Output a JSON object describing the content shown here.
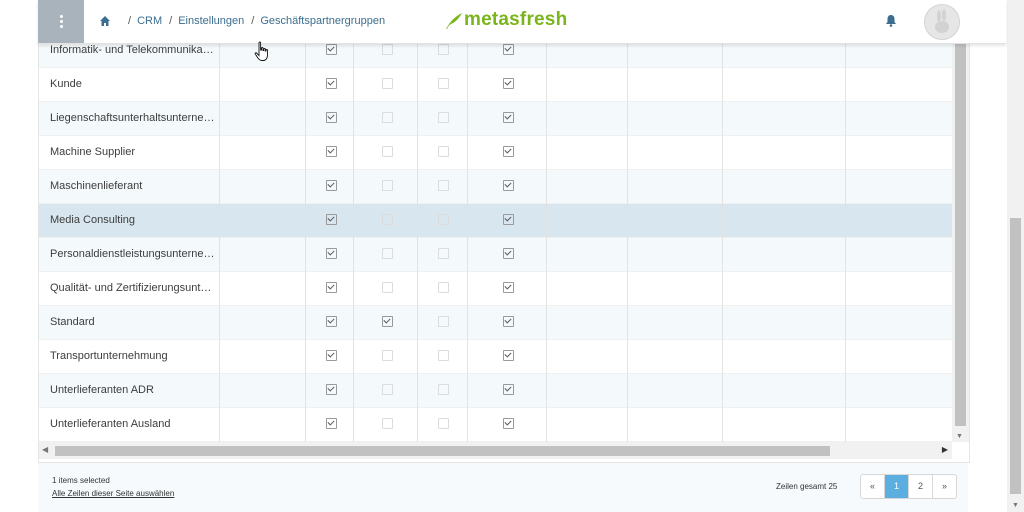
{
  "header": {
    "breadcrumb": [
      "CRM",
      "Einstellungen",
      "Geschäftspartnergruppen"
    ],
    "logo_text": "metasfresh",
    "logo_color": "#7ab51d",
    "menu_icon": "kebab-menu-icon",
    "home_icon": "home-icon",
    "notification_icon": "bell-icon",
    "avatar_icon": "rabbit-avatar-icon"
  },
  "table": {
    "rows": [
      {
        "name": "Informatik- und Telekommunikationsunternehmen",
        "checks": [
          true,
          false,
          false,
          true
        ],
        "selected": false
      },
      {
        "name": "Kunde",
        "checks": [
          true,
          false,
          false,
          true
        ],
        "selected": false
      },
      {
        "name": "Liegenschaftsunterhaltsunternehmen",
        "checks": [
          true,
          false,
          false,
          true
        ],
        "selected": false
      },
      {
        "name": "Machine Supplier",
        "checks": [
          true,
          false,
          false,
          true
        ],
        "selected": false
      },
      {
        "name": "Maschinenlieferant",
        "checks": [
          true,
          false,
          false,
          true
        ],
        "selected": false
      },
      {
        "name": "Media Consulting",
        "checks": [
          true,
          false,
          false,
          true
        ],
        "selected": true
      },
      {
        "name": "Personaldienstleistungsunternehmen",
        "checks": [
          true,
          false,
          false,
          true
        ],
        "selected": false
      },
      {
        "name": "Qualität- und Zertifizierungsunternehmen",
        "checks": [
          true,
          false,
          false,
          true
        ],
        "selected": false
      },
      {
        "name": "Standard",
        "checks": [
          true,
          true,
          false,
          true
        ],
        "selected": false
      },
      {
        "name": "Transportunternehmung",
        "checks": [
          true,
          false,
          false,
          true
        ],
        "selected": false
      },
      {
        "name": "Unterlieferanten ADR",
        "checks": [
          true,
          false,
          false,
          true
        ],
        "selected": false
      },
      {
        "name": "Unterlieferanten Ausland",
        "checks": [
          true,
          false,
          false,
          true
        ],
        "selected": false
      }
    ],
    "selected_row_color": "#d8e6ef",
    "alt_row_color": "#f4f9fc"
  },
  "footer": {
    "selected_count": "1 items selected",
    "select_all_link": "Alle Zeilen dieser Seite auswählen",
    "total_rows": "Zeilen gesamt 25",
    "pagination": {
      "prev": "«",
      "pages": [
        "1",
        "2"
      ],
      "current": "1",
      "next": "»"
    },
    "active_page_color": "#5bafe0"
  }
}
